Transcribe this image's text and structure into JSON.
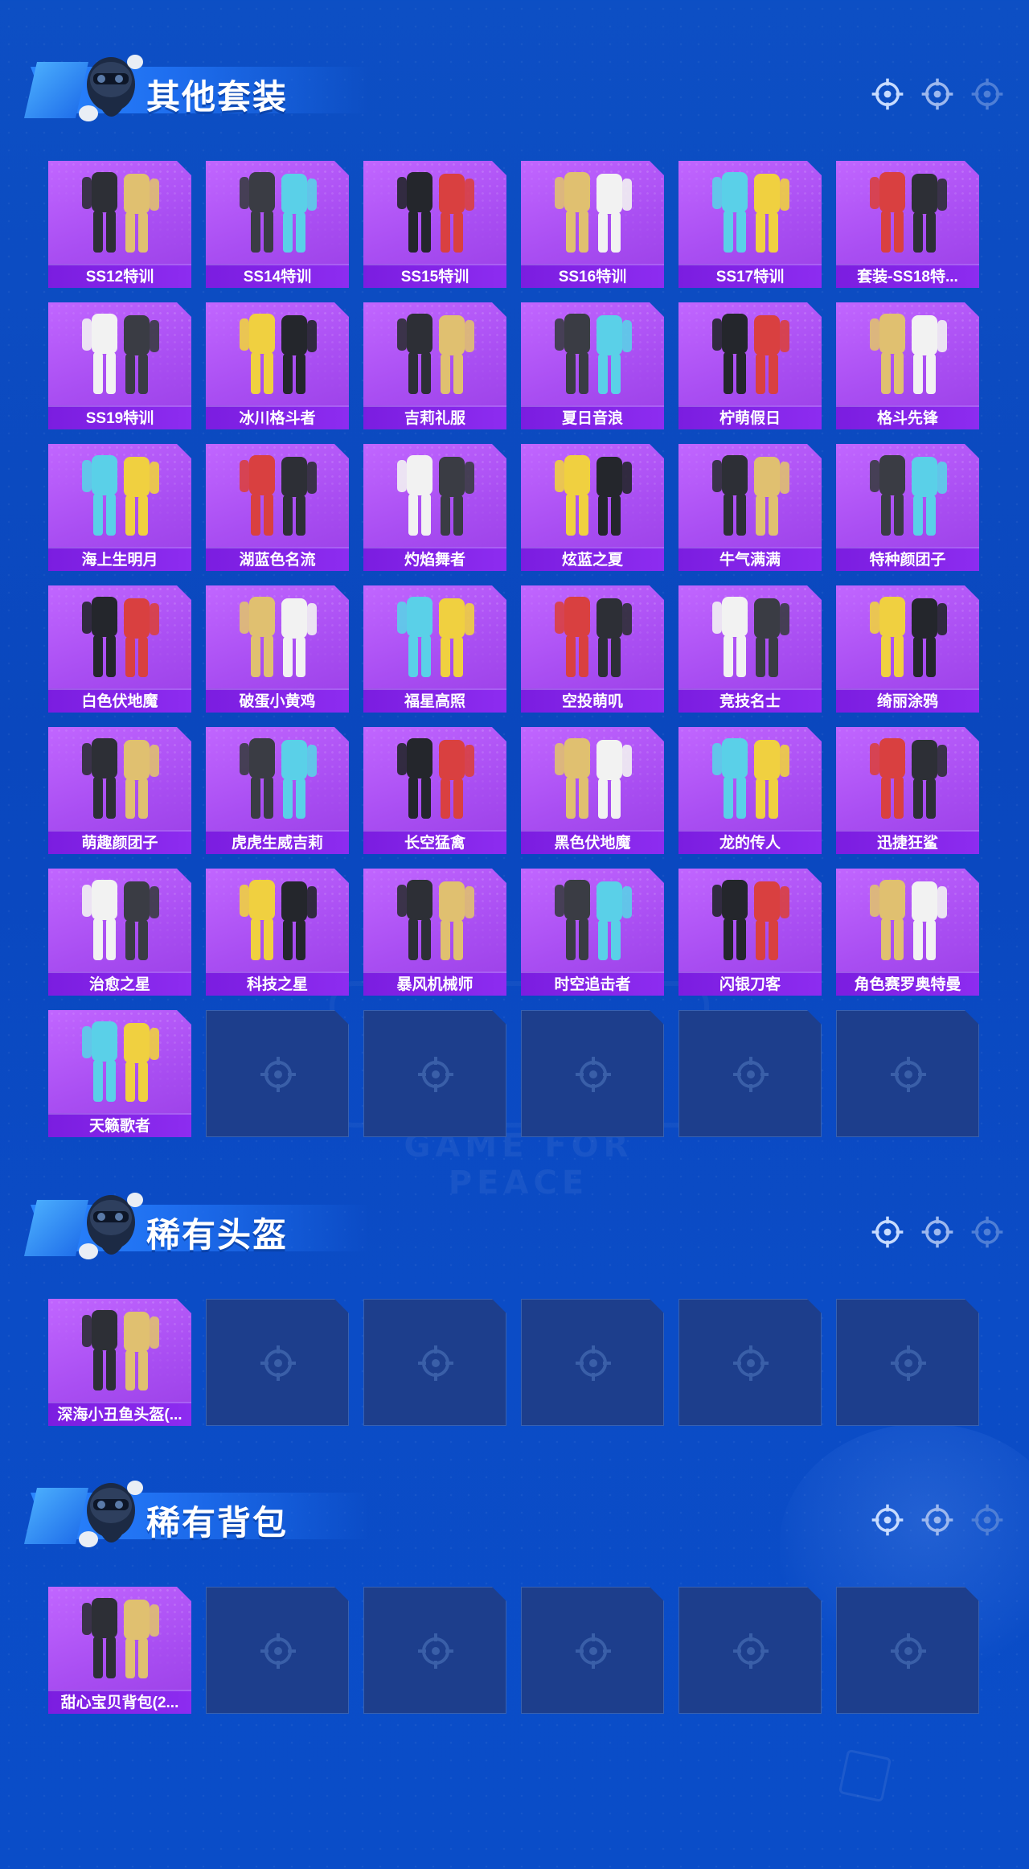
{
  "colors": {
    "background": "#0b4cc6",
    "card_filled": "#a94ef2",
    "label_bar": "#8d2cf0",
    "card_empty": "#1d3e8c",
    "title_text": "#ffffff"
  },
  "watermark": "GAME FOR PEACE",
  "sections": [
    {
      "title": "其他套装",
      "items": [
        "SS12特训",
        "SS14特训",
        "SS15特训",
        "SS16特训",
        "SS17特训",
        "套装-SS18特...",
        "SS19特训",
        "冰川格斗者",
        "吉莉礼服",
        "夏日音浪",
        "柠萌假日",
        "格斗先锋",
        "海上生明月",
        "湖蓝色名流",
        "灼焰舞者",
        "炫蓝之夏",
        "牛气满满",
        "特种颜团子",
        "白色伏地魔",
        "破蛋小黄鸡",
        "福星高照",
        "空投萌叽",
        "竞技名士",
        "绮丽涂鸦",
        "萌趣颜团子",
        "虎虎生威吉莉",
        "长空猛禽",
        "黑色伏地魔",
        "龙的传人",
        "迅捷狂鲨",
        "治愈之星",
        "科技之星",
        "暴风机械师",
        "时空追击者",
        "闪银刀客",
        "角色赛罗奥特曼",
        "天籁歌者"
      ],
      "empty_slots": 5
    },
    {
      "title": "稀有头盔",
      "items": [
        "深海小丑鱼头盔(..."
      ],
      "empty_slots": 5
    },
    {
      "title": "稀有背包",
      "items": [
        "甜心宝贝背包(2..."
      ],
      "empty_slots": 5
    }
  ]
}
